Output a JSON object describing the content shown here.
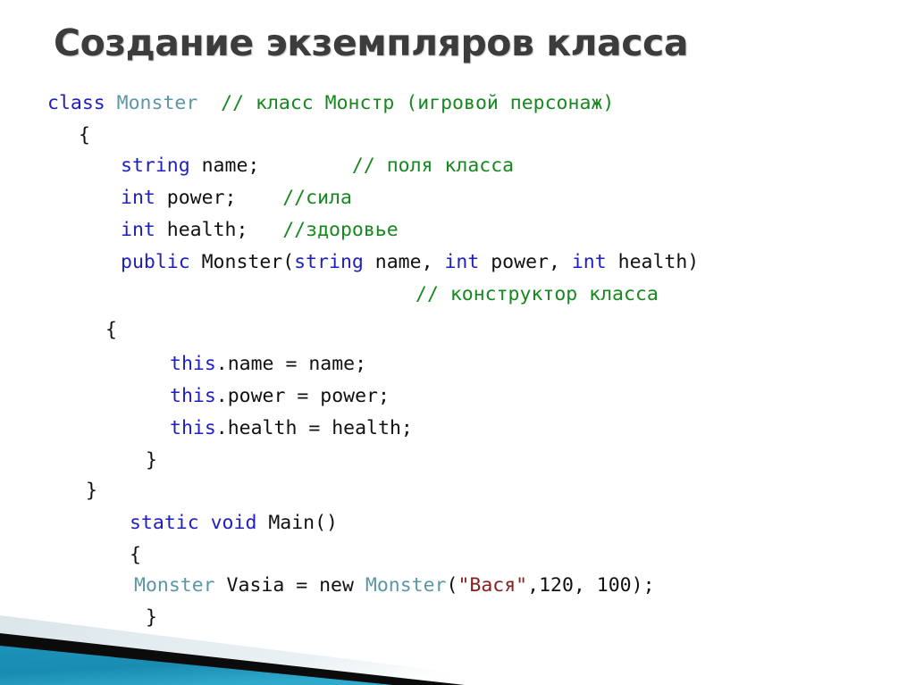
{
  "slide": {
    "title": "Создание экземпляров класса",
    "title_color": "#3c3c3c",
    "background_color": "#ffffff"
  },
  "theme": {
    "keyword_color": "#1f1fbe",
    "type_color": "#5b97a6",
    "comment_color": "#17881f",
    "string_color": "#85201f",
    "plain_color": "#111111",
    "accent_teal": "#1b8fb4",
    "accent_black": "#0b0b0b",
    "accent_pale": "#e1eaee"
  },
  "code": {
    "language": "csharp",
    "lines": [
      {
        "id": "line-class-decl",
        "indent": 53,
        "tokens": [
          {
            "t": "class ",
            "c": "kw"
          },
          {
            "t": "Monster",
            "c": "type"
          },
          {
            "t": "  ",
            "c": "pln"
          },
          {
            "t": "// класс Монстр (игровой персонаж)",
            "c": "cmt"
          }
        ]
      },
      {
        "id": "line-class-open-brace",
        "indent": 88,
        "tokens": [
          {
            "t": "{",
            "c": "pln"
          }
        ]
      },
      {
        "id": "line-field-name",
        "indent": 135,
        "tokens": [
          {
            "t": "string",
            "c": "kw"
          },
          {
            "t": " name;        ",
            "c": "pln"
          },
          {
            "t": "// поля класса",
            "c": "cmt"
          }
        ]
      },
      {
        "id": "line-field-power",
        "indent": 135,
        "tokens": [
          {
            "t": "int",
            "c": "kw"
          },
          {
            "t": " power;    ",
            "c": "pln"
          },
          {
            "t": "//сила",
            "c": "cmt"
          }
        ]
      },
      {
        "id": "line-field-health",
        "indent": 135,
        "tokens": [
          {
            "t": "int",
            "c": "kw"
          },
          {
            "t": " health;   ",
            "c": "pln"
          },
          {
            "t": "//здоровье",
            "c": "cmt"
          }
        ]
      },
      {
        "id": "line-ctor-signature",
        "indent": 135,
        "tokens": [
          {
            "t": "public",
            "c": "kw"
          },
          {
            "t": " Monster(",
            "c": "pln"
          },
          {
            "t": "string",
            "c": "kw"
          },
          {
            "t": " name, ",
            "c": "pln"
          },
          {
            "t": "int",
            "c": "kw"
          },
          {
            "t": " power, ",
            "c": "pln"
          },
          {
            "t": "int",
            "c": "kw"
          },
          {
            "t": " health)",
            "c": "pln"
          }
        ]
      },
      {
        "id": "line-ctor-comment",
        "indent": 465,
        "tokens": [
          {
            "t": "// конструктор класса",
            "c": "cmt"
          }
        ]
      },
      {
        "id": "line-ctor-open-brace",
        "indent": 118,
        "tokens": [
          {
            "t": "{",
            "c": "pln"
          }
        ]
      },
      {
        "id": "line-assign-name",
        "indent": 190,
        "tokens": [
          {
            "t": "this",
            "c": "kw"
          },
          {
            "t": ".name = name;",
            "c": "pln"
          }
        ]
      },
      {
        "id": "line-assign-power",
        "indent": 190,
        "tokens": [
          {
            "t": "this",
            "c": "kw"
          },
          {
            "t": ".power = power;",
            "c": "pln"
          }
        ]
      },
      {
        "id": "line-assign-health",
        "indent": 190,
        "tokens": [
          {
            "t": "this",
            "c": "kw"
          },
          {
            "t": ".health = health;",
            "c": "pln"
          }
        ]
      },
      {
        "id": "line-ctor-close-brace",
        "indent": 163,
        "tokens": [
          {
            "t": "}",
            "c": "pln"
          }
        ]
      },
      {
        "id": "line-class-close-brace",
        "indent": 96,
        "tokens": [
          {
            "t": "}",
            "c": "pln"
          }
        ]
      },
      {
        "id": "line-main-signature",
        "indent": 145,
        "tokens": [
          {
            "t": "static void",
            "c": "kw"
          },
          {
            "t": " Main()",
            "c": "pln"
          }
        ]
      },
      {
        "id": "line-main-open-brace",
        "indent": 145,
        "tokens": [
          {
            "t": "{",
            "c": "pln"
          }
        ]
      },
      {
        "id": "line-new-monster",
        "indent": 150,
        "tokens": [
          {
            "t": "Monster",
            "c": "type"
          },
          {
            "t": " Vasia = new ",
            "c": "pln"
          },
          {
            "t": "Monster",
            "c": "type"
          },
          {
            "t": "(",
            "c": "pln"
          },
          {
            "t": "\"Вася\"",
            "c": "str"
          },
          {
            "t": ",120, 100);",
            "c": "pln"
          }
        ]
      },
      {
        "id": "line-main-close-brace",
        "indent": 163,
        "tokens": [
          {
            "t": "}",
            "c": "pln"
          }
        ]
      }
    ]
  },
  "decoration": {
    "name": "bottom-left-diagonal-banner",
    "bands": [
      {
        "id": "pale-band",
        "color": "#e1eaee"
      },
      {
        "id": "black-band",
        "color": "#0b0b0b"
      },
      {
        "id": "teal-band",
        "color": "#1b8fb4"
      }
    ]
  }
}
